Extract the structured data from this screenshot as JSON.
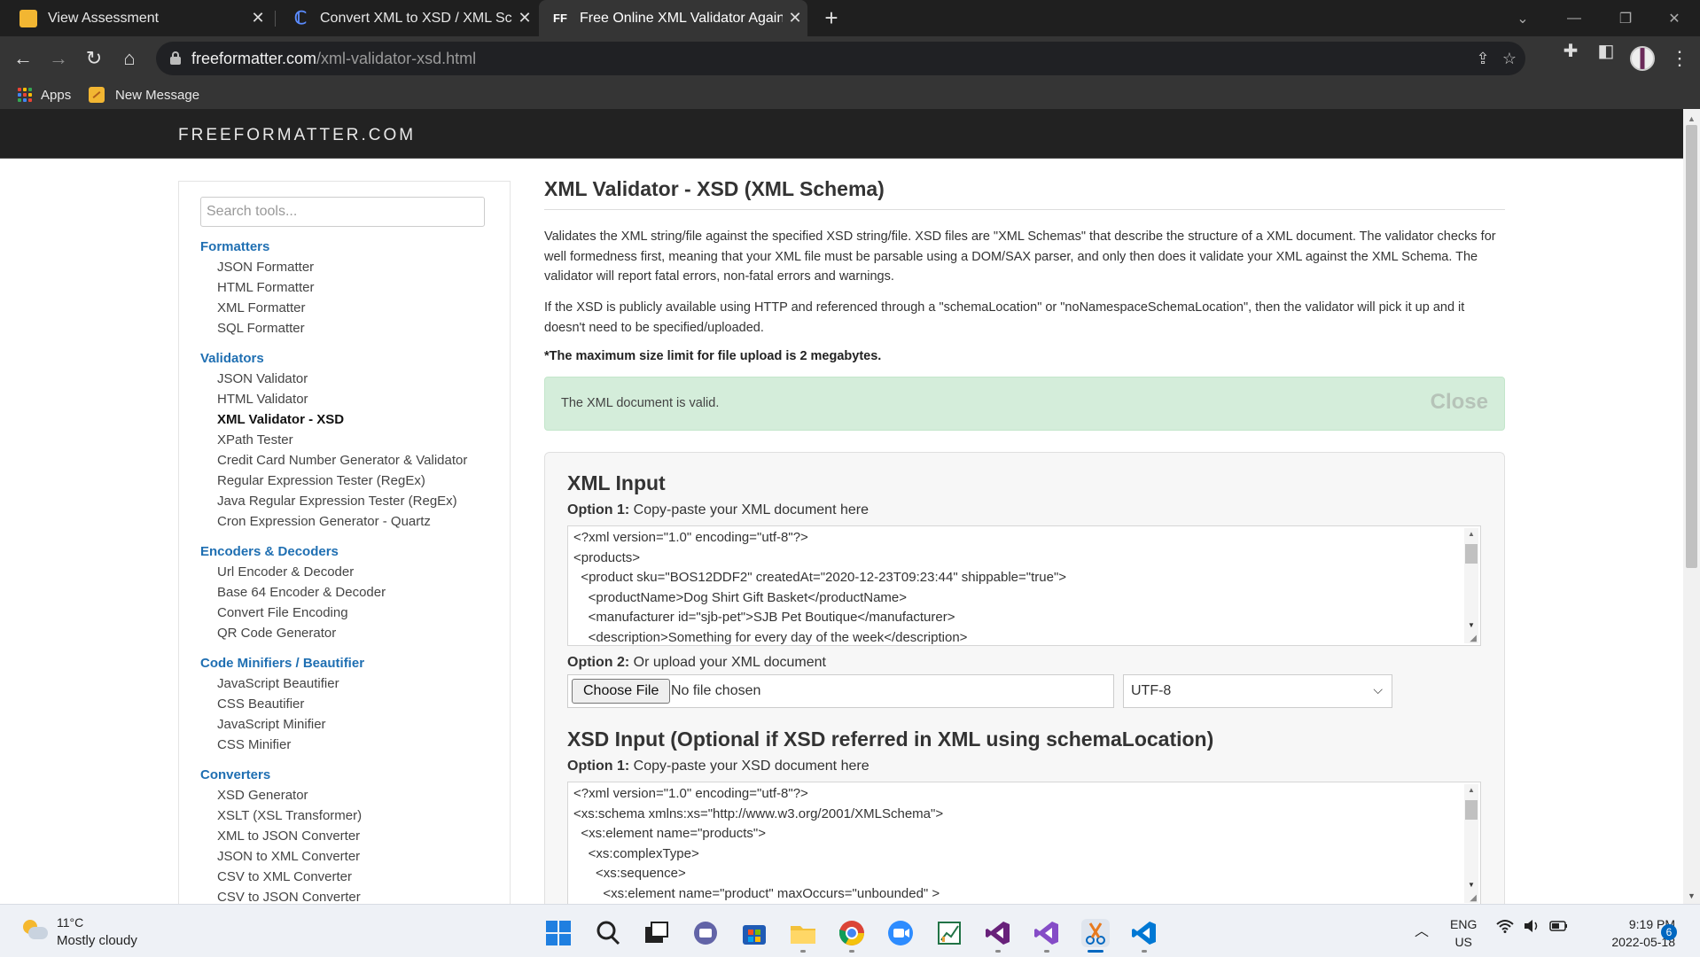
{
  "browser": {
    "tabs": [
      {
        "title": "View Assessment",
        "icon": "assessment-icon",
        "active": false
      },
      {
        "title": "Convert XML to XSD / XML Schema",
        "icon": "convert-icon",
        "active": false
      },
      {
        "title": "Free Online XML Validator Against XSD",
        "icon": "ff-icon",
        "icon_text": "FF",
        "active": true
      }
    ],
    "url_domain": "freeformatter.com",
    "url_path": "/xml-validator-xsd.html",
    "bookmarks": [
      {
        "label": "Apps",
        "icon": "apps-grid-icon"
      },
      {
        "label": "New Message",
        "icon": "note-icon"
      }
    ]
  },
  "site": {
    "logo": "FREEFORMATTER.COM",
    "search_placeholder": "Search tools...",
    "nav": [
      {
        "heading": "Formatters",
        "items": [
          "JSON Formatter",
          "HTML Formatter",
          "XML Formatter",
          "SQL Formatter"
        ]
      },
      {
        "heading": "Validators",
        "items": [
          "JSON Validator",
          "HTML Validator",
          "XML Validator - XSD",
          "XPath Tester",
          "Credit Card Number Generator & Validator",
          "Regular Expression Tester (RegEx)",
          "Java Regular Expression Tester (RegEx)",
          "Cron Expression Generator - Quartz"
        ]
      },
      {
        "heading": "Encoders & Decoders",
        "items": [
          "Url Encoder & Decoder",
          "Base 64 Encoder & Decoder",
          "Convert File Encoding",
          "QR Code Generator"
        ]
      },
      {
        "heading": "Code Minifiers / Beautifier",
        "items": [
          "JavaScript Beautifier",
          "CSS Beautifier",
          "JavaScript Minifier",
          "CSS Minifier"
        ]
      },
      {
        "heading": "Converters",
        "items": [
          "XSD Generator",
          "XSLT (XSL Transformer)",
          "XML to JSON Converter",
          "JSON to XML Converter",
          "CSV to XML Converter",
          "CSV to JSON Converter"
        ]
      }
    ],
    "active_item": "XML Validator - XSD"
  },
  "main": {
    "title": "XML Validator - XSD (XML Schema)",
    "desc1": "Validates the XML string/file against the specified XSD string/file. XSD files are \"XML Schemas\" that describe the structure of a XML document. The validator checks for well formedness first, meaning that your XML file must be parsable using a DOM/SAX parser, and only then does it validate your XML against the XML Schema. The validator will report fatal errors, non-fatal errors and warnings.",
    "desc2": "If the XSD is publicly available using HTTP and referenced through a \"schemaLocation\" or \"noNamespaceSchemaLocation\", then the validator will pick it up and it doesn't need to be specified/uploaded.",
    "size_note": "*The maximum size limit for file upload is 2 megabytes.",
    "alert_text": "The XML document is valid.",
    "alert_close": "Close",
    "xml_heading": "XML Input",
    "option_prefix": "Option 1:",
    "xml_option1": "Copy-paste your XML document here",
    "xml_code": "<?xml version=\"1.0\" encoding=\"utf-8\"?>\n<products>\n  <product sku=\"BOS12DDF2\" createdAt=\"2020-12-23T09:23:44\" shippable=\"true\">\n    <productName>Dog Shirt Gift Basket</productName>\n    <manufacturer id=\"sjb-pet\">SJB Pet Boutique</manufacturer>\n    <description>Something for every day of the week</description>",
    "option2_prefix": "Option 2:",
    "xml_option2": "Or upload your XML document",
    "choose_file": "Choose File",
    "no_file": "No file chosen",
    "encoding": "UTF-8",
    "xsd_heading": "XSD Input (Optional if XSD referred in XML using schemaLocation)",
    "xsd_option1": "Copy-paste your XSD document here",
    "xsd_code": "<?xml version=\"1.0\" encoding=\"utf-8\"?>\n<xs:schema xmlns:xs=\"http://www.w3.org/2001/XMLSchema\">\n  <xs:element name=\"products\">\n    <xs:complexType>\n      <xs:sequence>\n        <xs:element name=\"product\" maxOccurs=\"unbounded\" >"
  },
  "taskbar": {
    "temp": "11°C",
    "weather": "Mostly cloudy",
    "lang1": "ENG",
    "lang2": "US",
    "time": "9:19 PM",
    "date": "2022-05-18",
    "notifications": "6",
    "apps": [
      "start-icon",
      "search-icon",
      "task-view-icon",
      "chat-icon",
      "store-icon",
      "file-explorer-icon",
      "chrome-icon",
      "zoom-icon",
      "excel-icon",
      "visual-studio-icon",
      "visual-studio-icon",
      "snipping-tool-icon",
      "vscode-icon"
    ]
  },
  "colors": {
    "link": "#1f6fb2",
    "alert_bg": "#d4edda",
    "chrome_dark": "#1f1f1f",
    "taskbar_accent": "#0067c0"
  }
}
